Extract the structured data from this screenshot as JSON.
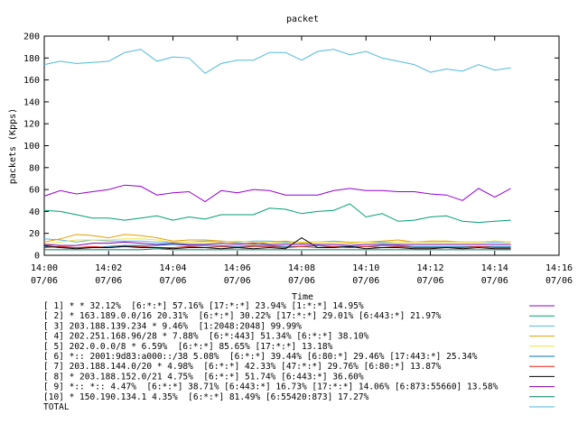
{
  "chart_data": {
    "type": "line",
    "title": "packet",
    "xlabel": "Time",
    "ylabel": "packets (Kpps)",
    "ylim": [
      0,
      200
    ],
    "yticks": [
      0,
      20,
      40,
      60,
      80,
      100,
      120,
      140,
      160,
      180,
      200
    ],
    "xlim": [
      "14:00",
      "14:16"
    ],
    "xticks": [
      {
        "time": "14:00",
        "date": "07/06"
      },
      {
        "time": "14:02",
        "date": "07/06"
      },
      {
        "time": "14:04",
        "date": "07/06"
      },
      {
        "time": "14:06",
        "date": "07/06"
      },
      {
        "time": "14:08",
        "date": "07/06"
      },
      {
        "time": "14:10",
        "date": "07/06"
      },
      {
        "time": "14:12",
        "date": "07/06"
      },
      {
        "time": "14:14",
        "date": "07/06"
      },
      {
        "time": "14:16",
        "date": "07/06"
      }
    ],
    "x": [
      "14:00:00",
      "14:00:30",
      "14:01:00",
      "14:01:30",
      "14:02:00",
      "14:02:30",
      "14:03:00",
      "14:03:30",
      "14:04:00",
      "14:04:30",
      "14:05:00",
      "14:05:30",
      "14:06:00",
      "14:06:30",
      "14:07:00",
      "14:07:30",
      "14:08:00",
      "14:08:30",
      "14:09:00",
      "14:09:30",
      "14:10:00",
      "14:10:30",
      "14:11:00",
      "14:11:30",
      "14:12:00",
      "14:12:30",
      "14:13:00",
      "14:13:30",
      "14:14:00",
      "14:14:30"
    ],
    "grid": false,
    "legend_position": "bottom",
    "series": [
      {
        "name": "[ 1] * * 32.12%  [6:*:*] 57.16% [17:*:*] 23.94% [1:*:*] 14.95%",
        "color": "#9400d3",
        "values": [
          54,
          59,
          56,
          58,
          60,
          64,
          63,
          55,
          57,
          58,
          49,
          59,
          57,
          60,
          59,
          55,
          55,
          55,
          59,
          61,
          59,
          59,
          58,
          58,
          56,
          55,
          50,
          61,
          53,
          61
        ]
      },
      {
        "name": "[ 2] * 163.189.0.0/16 20.31%  [6:*:*] 30.22% [17:*:*] 29.01% [6:443:*] 21.97%",
        "color": "#009e73",
        "values": [
          41,
          40,
          37,
          34,
          34,
          32,
          34,
          36,
          32,
          35,
          33,
          37,
          37,
          37,
          43,
          42,
          38,
          40,
          41,
          47,
          35,
          38,
          31,
          32,
          35,
          36,
          31,
          30,
          31,
          32
        ]
      },
      {
        "name": "[ 3] 203.188.139.234 * 9.46%  [1:2048:2048] 99.99%",
        "color": "#56b4e9",
        "values": [
          15,
          14,
          12,
          14,
          13,
          13,
          13,
          12,
          12,
          12,
          13,
          13,
          12,
          13,
          13,
          12,
          12,
          12,
          13,
          12,
          12,
          12,
          12,
          12,
          12,
          12,
          12,
          12,
          12,
          12
        ]
      },
      {
        "name": "[ 4] 202.251.168.96/28 * 7.88%  [6:*:443] 51.34% [6:*:*] 38.10%",
        "color": "#e69f00",
        "values": [
          12,
          15,
          19,
          18,
          16,
          19,
          18,
          16,
          13,
          14,
          14,
          13,
          11,
          10,
          12,
          13,
          11,
          12,
          12,
          11,
          12,
          13,
          14,
          12,
          13,
          13,
          12,
          12,
          13,
          12
        ]
      },
      {
        "name": "[ 5] 202.0.0.0/8 * 6.59%  [6:*:*] 85.65% [17:*:*] 13.18%",
        "color": "#f0e442",
        "values": [
          10,
          12,
          14,
          14,
          14,
          15,
          15,
          14,
          12,
          12,
          12,
          12,
          13,
          12,
          12,
          11,
          12,
          12,
          12,
          12,
          12,
          11,
          12,
          12,
          12,
          12,
          12,
          12,
          13,
          12
        ]
      },
      {
        "name": "[ 6] *:: 2001:9d83:a000::/38 5.08%  [6:*:*] 39.44% [6:80:*] 29.46% [17:443:*] 25.34%",
        "color": "#0072b2",
        "values": [
          8,
          7,
          7,
          7,
          8,
          9,
          9,
          9,
          10,
          9,
          9,
          9,
          8,
          9,
          9,
          8,
          8,
          9,
          8,
          8,
          8,
          9,
          9,
          8,
          8,
          8,
          8,
          8,
          8,
          8
        ]
      },
      {
        "name": "[ 7] 203.188.144.0/20 * 4.98%  [6:*:*] 42.33% [47:*:*] 29.76% [6:80:*] 13.87%",
        "color": "#e51e10",
        "values": [
          7,
          8,
          7,
          8,
          7,
          8,
          8,
          7,
          7,
          8,
          7,
          8,
          7,
          8,
          8,
          7,
          8,
          7,
          8,
          7,
          8,
          7,
          8,
          7,
          7,
          7,
          7,
          8,
          7,
          7
        ]
      },
      {
        "name": "[ 8] * 203.188.152.0/21 4.75%  [6:*:*] 51.74% [6:443:*] 36.60%",
        "color": "#000000",
        "values": [
          9,
          7,
          6,
          7,
          7,
          8,
          7,
          7,
          6,
          7,
          7,
          6,
          7,
          6,
          7,
          6,
          16,
          7,
          7,
          8,
          6,
          7,
          7,
          6,
          6,
          7,
          6,
          7,
          6,
          6
        ]
      },
      {
        "name": "[ 9] *:: *:: 4.47%  [6:*:*] 38.71% [6:443:*] 16.73% [17:*:*] 14.06% [6:873:55660] 13.58%",
        "color": "#7b00b4",
        "values": [
          10,
          9,
          9,
          11,
          11,
          12,
          11,
          10,
          11,
          10,
          10,
          11,
          10,
          11,
          10,
          10,
          10,
          10,
          10,
          9,
          10,
          10,
          10,
          10,
          10,
          10,
          10,
          10,
          10,
          10
        ]
      },
      {
        "name": "[10] * 150.190.134.1 4.35%  [6:*:*] 81.49% [6:55420:873] 17.27%",
        "color": "#008060",
        "values": [
          5,
          5,
          5,
          5,
          5,
          5,
          5,
          6,
          5,
          5,
          5,
          5,
          5,
          5,
          5,
          5,
          5,
          5,
          5,
          5,
          5,
          5,
          5,
          5,
          5,
          5,
          5,
          5,
          5,
          5
        ]
      },
      {
        "name": "TOTAL",
        "color": "#4fb9dc",
        "values": [
          174,
          177,
          175,
          176,
          177,
          185,
          188,
          177,
          181,
          180,
          166,
          175,
          178,
          178,
          185,
          185,
          178,
          186,
          188,
          183,
          186,
          180,
          177,
          174,
          167,
          170,
          168,
          174,
          169,
          171
        ]
      }
    ]
  }
}
